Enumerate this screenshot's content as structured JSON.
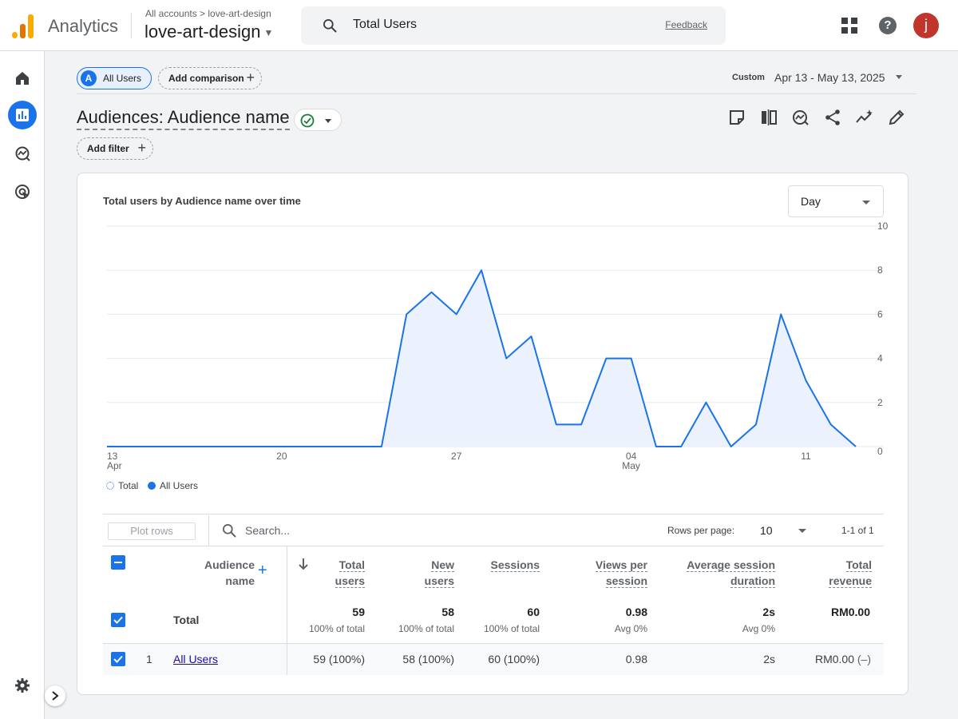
{
  "app": {
    "name": "Analytics"
  },
  "account": {
    "crumbs": "All accounts > love-art-design",
    "property": "love-art-design"
  },
  "search": {
    "query": "Total Users",
    "feedback": "Feedback"
  },
  "user": {
    "avatar_letter": "j"
  },
  "comparison": {
    "segment_badge": "A",
    "segment": "All Users",
    "add_comparison": "Add comparison"
  },
  "date": {
    "custom": "Custom",
    "range": "Apr 13 - May 13, 2025"
  },
  "report": {
    "title": "Audiences: Audience name",
    "add_filter": "Add filter"
  },
  "card": {
    "title": "Total users by Audience name over time",
    "granularity": "Day"
  },
  "chart_data": {
    "type": "area",
    "title": "Total users by Audience name over time",
    "x": [
      "Apr 13",
      "Apr 14",
      "Apr 15",
      "Apr 16",
      "Apr 17",
      "Apr 18",
      "Apr 19",
      "Apr 20",
      "Apr 21",
      "Apr 22",
      "Apr 23",
      "Apr 24",
      "Apr 25",
      "Apr 26",
      "Apr 27",
      "Apr 28",
      "Apr 29",
      "Apr 30",
      "May 1",
      "May 2",
      "May 3",
      "May 4",
      "May 5",
      "May 6",
      "May 7",
      "May 8",
      "May 9",
      "May 10",
      "May 11",
      "May 12",
      "May 13"
    ],
    "series": [
      {
        "name": "All Users",
        "values": [
          0,
          0,
          0,
          0,
          0,
          0,
          0,
          0,
          0,
          0,
          0,
          0,
          6,
          7,
          6,
          8,
          4,
          5,
          1,
          1,
          4,
          4,
          0,
          0,
          2,
          0,
          1,
          6,
          3,
          1,
          0
        ]
      }
    ],
    "x_ticks": [
      {
        "index": 0,
        "label": "13",
        "sublabel": "Apr"
      },
      {
        "index": 7,
        "label": "20",
        "sublabel": ""
      },
      {
        "index": 14,
        "label": "27",
        "sublabel": ""
      },
      {
        "index": 21,
        "label": "04",
        "sublabel": "May"
      },
      {
        "index": 28,
        "label": "11",
        "sublabel": ""
      }
    ],
    "y_ticks": [
      "0",
      "2",
      "4",
      "6",
      "8",
      "10"
    ],
    "ylim": [
      0,
      10
    ],
    "grid": true,
    "legend": [
      "Total",
      "All Users"
    ],
    "legend_placement": "bottom-left",
    "colors": {
      "line": "#1a73e8",
      "fill": "#e8f0fe"
    }
  },
  "table": {
    "plot_rows": "Plot rows",
    "search_placeholder": "Search...",
    "rows_per_page_label": "Rows per page:",
    "rows_per_page": "10",
    "pagination": "1-1 of 1",
    "headers": {
      "dimension": [
        "Audience",
        "name"
      ],
      "total_users": [
        "Total",
        "users"
      ],
      "new_users": [
        "New",
        "users"
      ],
      "sessions": [
        "Sessions"
      ],
      "views_per_session": [
        "Views per",
        "session"
      ],
      "avg_session_duration": [
        "Average session",
        "duration"
      ],
      "total_revenue": [
        "Total",
        "revenue"
      ]
    },
    "total_row": {
      "label": "Total",
      "total_users": "59",
      "total_users_sub": "100% of total",
      "new_users": "58",
      "new_users_sub": "100% of total",
      "sessions": "60",
      "sessions_sub": "100% of total",
      "views_per_session": "0.98",
      "views_per_session_sub": "Avg 0%",
      "avg_session_duration": "2s",
      "avg_session_duration_sub": "Avg 0%",
      "total_revenue": "RM0.00"
    },
    "rows": [
      {
        "index": "1",
        "name": "All Users",
        "total_users": "59 (100%)",
        "new_users": "58 (100%)",
        "sessions": "60 (100%)",
        "views_per_session": "0.98",
        "avg_session_duration": "2s",
        "total_revenue": "RM0.00",
        "total_revenue_delta": "(–)"
      }
    ]
  }
}
